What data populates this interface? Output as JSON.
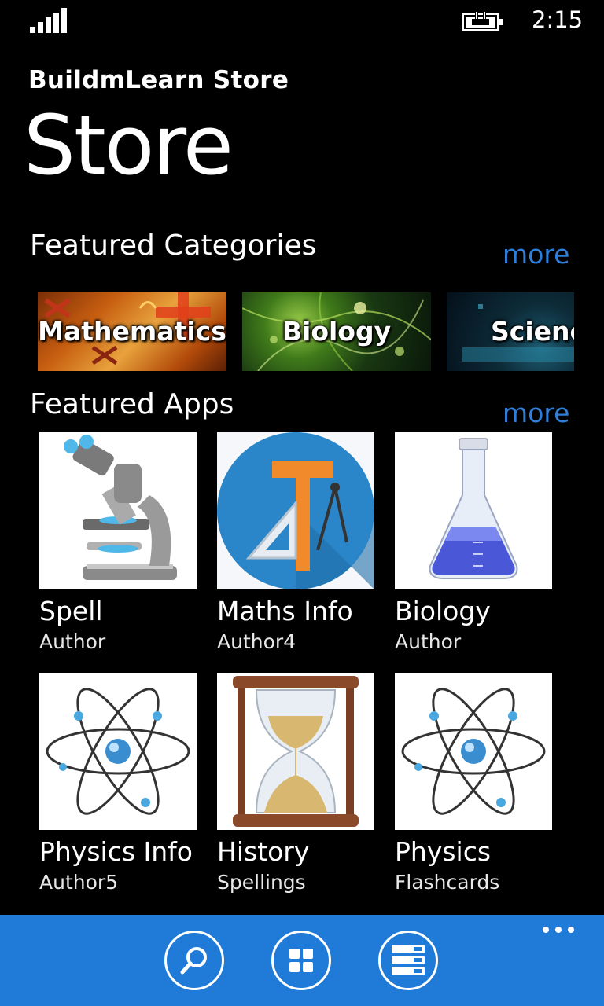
{
  "status": {
    "time": "2:15"
  },
  "header": {
    "app_title": "BuildmLearn Store",
    "page_title": "Store"
  },
  "featured_categories": {
    "title": "Featured Categories",
    "more_label": "more",
    "items": [
      {
        "label": "Mathematics"
      },
      {
        "label": "Biology"
      },
      {
        "label": "Science"
      }
    ]
  },
  "featured_apps": {
    "title": "Featured Apps",
    "more_label": "more",
    "items": [
      {
        "name": "Spell",
        "author": "Author",
        "icon": "microscope-icon"
      },
      {
        "name": "Maths Info",
        "author": "Author4",
        "icon": "geometry-tools-icon"
      },
      {
        "name": "Biology",
        "author": "Author",
        "icon": "flask-icon"
      },
      {
        "name": "Physics Info",
        "author": "Author5",
        "icon": "atom-icon"
      },
      {
        "name": "History",
        "author": "Spellings",
        "icon": "hourglass-icon"
      },
      {
        "name": "Physics",
        "author": "Flashcards",
        "icon": "atom-icon"
      }
    ]
  },
  "app_bar": {
    "buttons": [
      "search-icon",
      "grid-icon",
      "list-icon"
    ],
    "accent_color": "#1f7ad8"
  },
  "colors": {
    "link": "#2f7ed8",
    "background": "#000000"
  }
}
